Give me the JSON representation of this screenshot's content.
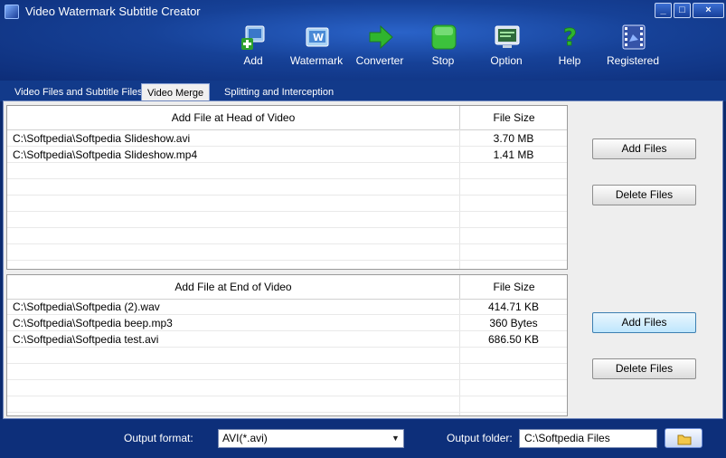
{
  "window": {
    "title": "Video Watermark  Subtitle Creator",
    "minimize": "_",
    "maximize": "□",
    "close": "×"
  },
  "toolbar": [
    {
      "label": "Add",
      "icon": "add-video-icon"
    },
    {
      "label": "Watermark",
      "icon": "watermark-icon"
    },
    {
      "label": "Converter",
      "icon": "converter-arrow-icon"
    },
    {
      "label": "Stop",
      "icon": "stop-icon"
    },
    {
      "label": "Option",
      "icon": "option-monitor-icon"
    },
    {
      "label": "Help",
      "icon": "help-icon"
    },
    {
      "label": "Registered",
      "icon": "registered-film-icon"
    }
  ],
  "tabs": [
    {
      "label": "Video Files and Subtitle Files",
      "active": false
    },
    {
      "label": "Video Merge",
      "active": true
    },
    {
      "label": "Splitting and Interception",
      "active": false
    }
  ],
  "head_list": {
    "col_name": "Add File at Head of Video",
    "col_size": "File Size",
    "rows": [
      {
        "name": "C:\\Softpedia\\Softpedia Slideshow.avi",
        "size": "3.70 MB"
      },
      {
        "name": "C:\\Softpedia\\Softpedia Slideshow.mp4",
        "size": "1.41 MB"
      }
    ],
    "add_button": "Add Files",
    "delete_button": "Delete Files"
  },
  "end_list": {
    "col_name": "Add File at End of Video",
    "col_size": "File Size",
    "rows": [
      {
        "name": "C:\\Softpedia\\Softpedia (2).wav",
        "size": "414.71 KB"
      },
      {
        "name": "C:\\Softpedia\\Softpedia beep.mp3",
        "size": "360 Bytes"
      },
      {
        "name": "C:\\Softpedia\\Softpedia test.avi",
        "size": "686.50 KB"
      }
    ],
    "add_button": "Add Files",
    "delete_button": "Delete Files"
  },
  "bottom": {
    "output_format_label": "Output format:",
    "output_format_value": "AVI(*.avi)",
    "output_folder_label": "Output folder:",
    "output_folder_value": "C:\\Softpedia Files"
  },
  "colors": {
    "header": "#164197",
    "panel": "#eeeeee",
    "bottom": "#0d2f7a",
    "converter_green": "#2fb52f",
    "stop_green": "#3cc23c"
  }
}
